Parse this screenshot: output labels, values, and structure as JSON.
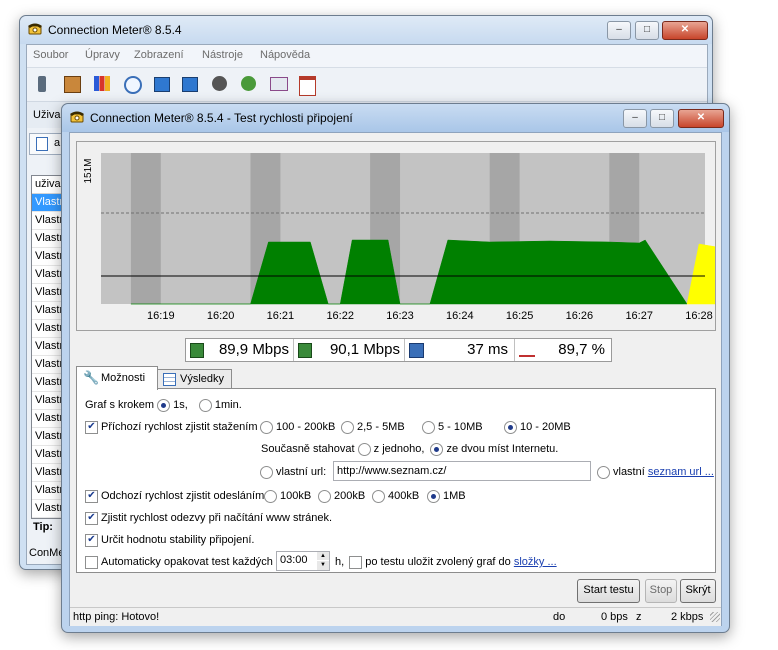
{
  "main_window": {
    "title": "Connection Meter® 8.5.4",
    "menu": [
      "Soubor",
      "Úpravy",
      "Zobrazení",
      "Nástroje",
      "Nápověda"
    ],
    "toolbar_icons": [
      "phone-icon",
      "modem-icon",
      "chart-bars-icon",
      "clock-icon",
      "network-up-icon",
      "network-down-icon",
      "gauge-icon",
      "globe-icon",
      "mail-icon",
      "calendar-icon"
    ],
    "filter_label": "Uživa",
    "tab_label": "a",
    "list_header": "uživa",
    "list_items": [
      "Vlastn",
      "Vlastn",
      "Vlastn",
      "Vlastn",
      "Vlastn",
      "Vlastn",
      "Vlastn",
      "Vlastn",
      "Vlastn",
      "Vlastn",
      "Vlastn",
      "Vlastn",
      "Vlastn",
      "Vlastn",
      "Vlastn",
      "Vlastn",
      "Vlastn",
      "Vlastn"
    ],
    "tip_label": "Tip:",
    "status_text": "ConMe"
  },
  "dialog": {
    "title": "Connection Meter® 8.5.4 - Test rychlosti připojení",
    "chart_data": {
      "type": "area",
      "ylabel": "151M",
      "x_ticks": [
        "16:19",
        "16:20",
        "16:21",
        "16:22",
        "16:23",
        "16:24",
        "16:25",
        "16:26",
        "16:27",
        "16:28"
      ],
      "series": [
        {
          "color": "#008000",
          "points": [
            [
              16.19,
              0
            ],
            [
              16.2,
              0
            ],
            [
              16.21,
              0
            ],
            [
              16.213,
              62
            ],
            [
              16.22,
              62
            ],
            [
              16.223,
              0
            ],
            [
              16.225,
              0
            ],
            [
              16.227,
              64
            ],
            [
              16.233,
              64
            ],
            [
              16.235,
              0
            ],
            [
              16.24,
              0
            ],
            [
              16.243,
              64
            ],
            [
              16.25,
              62
            ],
            [
              16.26,
              63
            ],
            [
              16.27,
              62
            ],
            [
              16.275,
              61
            ],
            [
              16.276,
              64
            ],
            [
              16.283,
              0
            ]
          ]
        },
        {
          "color": "#ffff00",
          "points": [
            [
              16.283,
              0
            ],
            [
              16.285,
              60
            ],
            [
              16.29,
              55
            ],
            [
              16.295,
              0
            ]
          ]
        }
      ],
      "ylim": [
        0,
        151
      ],
      "reference_lines": [
        {
          "style": "dashed",
          "value": 91
        },
        {
          "style": "solid",
          "value": 28
        }
      ]
    },
    "stats": [
      {
        "icon": "download-icon",
        "value": "89,9 Mbps"
      },
      {
        "icon": "upload-icon",
        "value": "90,1 Mbps"
      },
      {
        "icon": "ping-icon",
        "value": "37 ms"
      },
      {
        "icon": "stability-icon",
        "value": "89,7 %"
      }
    ],
    "tabs": {
      "options": "Možnosti",
      "results": "Výsledky"
    },
    "options": {
      "graph_step_label": "Graf s krokem",
      "graph_step_1s": "1s,",
      "graph_step_1min": "1min.",
      "download_check": "Příchozí rychlost zjistit stažením",
      "dl_100_200": "100 - 200kB",
      "dl_2_5": "2,5 - 5MB",
      "dl_5_10": "5 - 10MB",
      "dl_10_20": "10 - 20MB",
      "concurrent_label": "Současně stahovat",
      "concurrent_one": "z jednoho,",
      "concurrent_two": "ze dvou míst Internetu.",
      "own_url_label": "vlastní url:",
      "own_url_value": "http://www.seznam.cz/",
      "own_list_label": "vlastní",
      "own_list_link": "seznam url ...",
      "upload_check": "Odchozí rychlost zjistit odesláním",
      "ul_100": "100kB",
      "ul_200": "200kB",
      "ul_400": "400kB",
      "ul_1mb": "1MB",
      "response_check": "Zjistit rychlost odezvy při načítání www stránek.",
      "stability_check": "Určit hodnotu stability připojení.",
      "auto_repeat": "Automaticky opakovat test každých",
      "auto_repeat_value": "03:00",
      "hours_suffix": "h,",
      "save_graph": "po testu uložit zvolený graf do",
      "folder_link": "složky ..."
    },
    "buttons": {
      "start": "Start testu",
      "stop": "Stop",
      "hide": "Skrýt"
    },
    "status": {
      "left": "http ping: Hotovo!",
      "do_label": "do",
      "do_value": "0 bps",
      "z_label": "z",
      "z_value": "2 kbps"
    }
  }
}
